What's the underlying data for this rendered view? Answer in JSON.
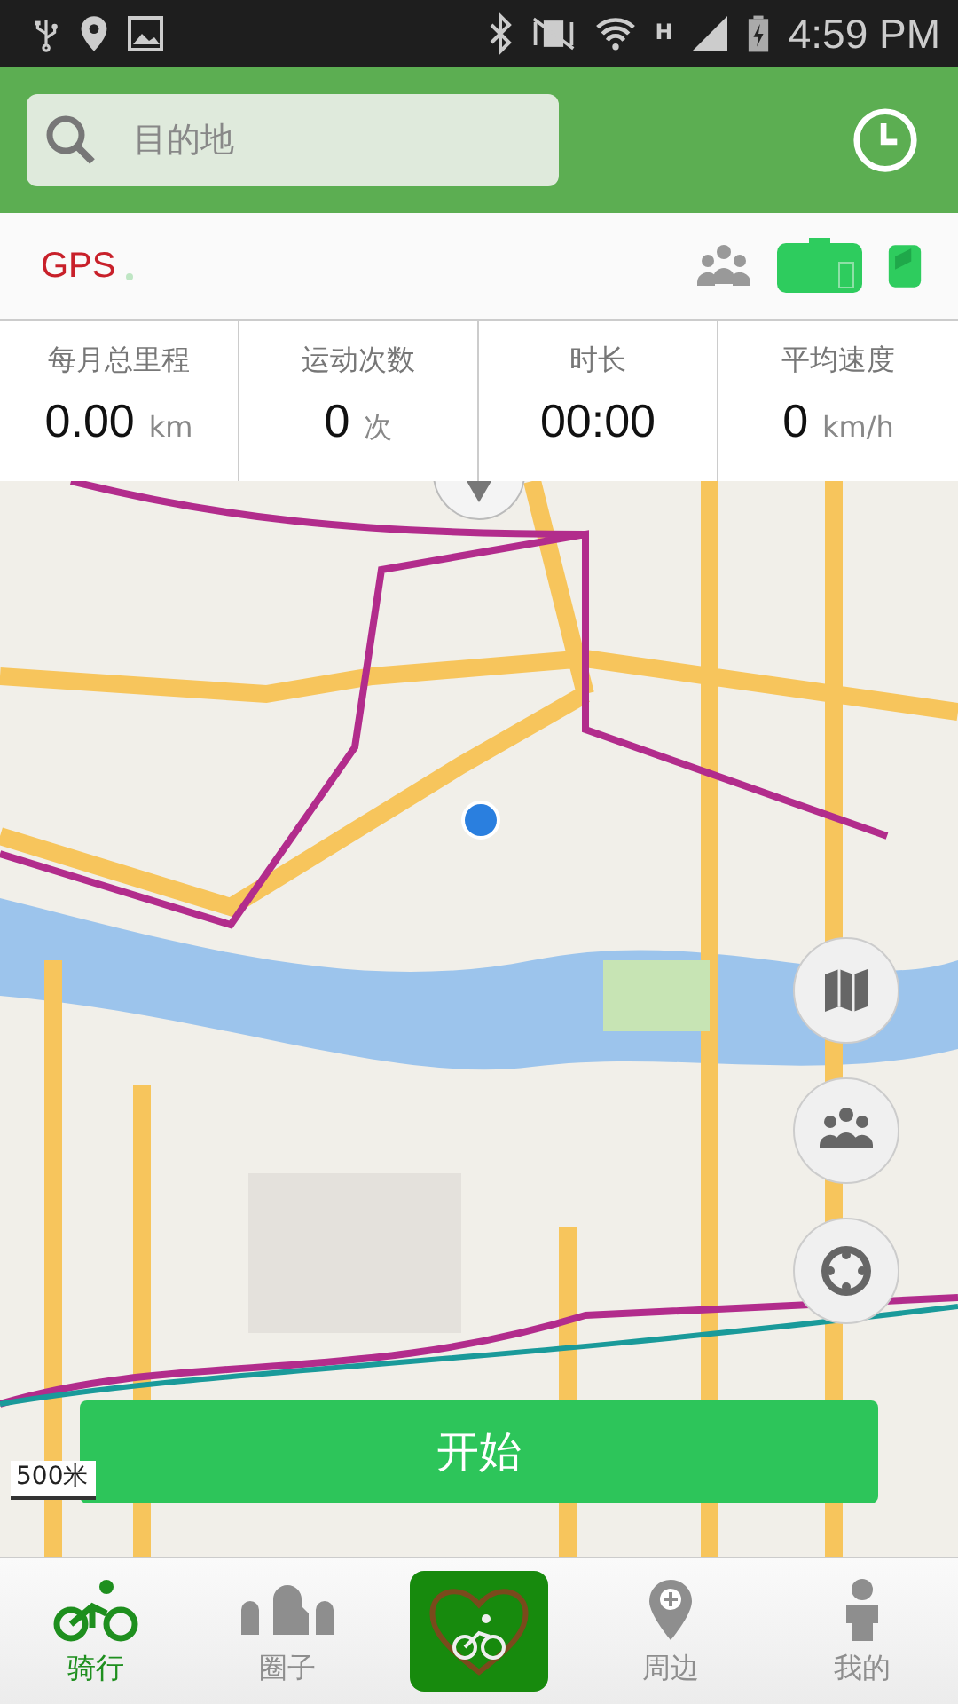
{
  "status_bar": {
    "time": "4:59 PM",
    "network": "H"
  },
  "search": {
    "placeholder": "目的地"
  },
  "gps": {
    "label": "GPS"
  },
  "stats": [
    {
      "label": "每月总里程",
      "value": "0.00",
      "unit": "km"
    },
    {
      "label": "运动次数",
      "value": "0",
      "unit": "次"
    },
    {
      "label": "时长",
      "value": "00:00"
    },
    {
      "label": "平均速度",
      "value": "0",
      "unit": "km/h"
    }
  ],
  "map": {
    "scale": "500米"
  },
  "start_button": "开始",
  "tabs": [
    {
      "kind": "ride",
      "label": "骑行",
      "selected": true
    },
    {
      "kind": "circle",
      "label": "圈子",
      "selected": false
    },
    {
      "kind": "center",
      "selected": false
    },
    {
      "kind": "nearby",
      "label": "周边",
      "selected": false
    },
    {
      "kind": "me",
      "label": "我的",
      "selected": false
    }
  ]
}
